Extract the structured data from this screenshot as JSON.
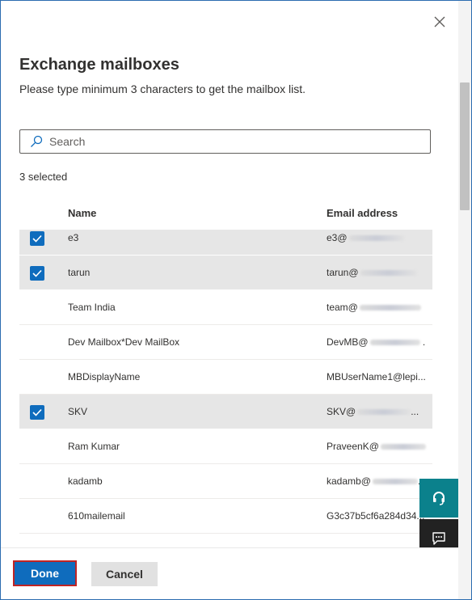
{
  "panel": {
    "title": "Exchange mailboxes",
    "subtitle": "Please type minimum 3 characters to get the mailbox list."
  },
  "search": {
    "placeholder": "Search",
    "value": ""
  },
  "selection_count": "3 selected",
  "columns": {
    "name": "Name",
    "email": "Email address"
  },
  "rows": [
    {
      "name": "e3",
      "email": "e3@",
      "selected": true
    },
    {
      "name": "tarun",
      "email": "tarun@",
      "email_suffix": "",
      "selected": true
    },
    {
      "name": "Team India",
      "email": "team@",
      "selected": false
    },
    {
      "name": "Dev Mailbox*Dev MailBox",
      "email": "DevMB@",
      "email_suffix": ".",
      "selected": false
    },
    {
      "name": "MBDisplayName",
      "email": "MBUserName1@lepi...",
      "selected": false
    },
    {
      "name": "SKV",
      "email": "SKV@",
      "email_suffix": "...",
      "selected": true
    },
    {
      "name": "Ram Kumar",
      "email": "PraveenK@",
      "selected": false
    },
    {
      "name": "kadamb",
      "email": "kadamb@",
      "email_suffix": "...",
      "selected": false
    },
    {
      "name": "610mailemail",
      "email": "G3c37b5cf6a284d34...",
      "selected": false
    },
    {
      "name": "",
      "email": "",
      "selected": false
    }
  ],
  "footer": {
    "done_label": "Done",
    "cancel_label": "Cancel"
  },
  "icons": {
    "close": "close-icon",
    "search": "search-icon",
    "checkbox": "checkmark-icon",
    "support": "headset-icon",
    "feedback": "feedback-icon"
  },
  "colors": {
    "primary": "#0f6cbd",
    "selected_row": "#e6e6e6",
    "support_fab": "#0b818c",
    "feedback_fab": "#222222",
    "done_outline": "#c02424"
  }
}
